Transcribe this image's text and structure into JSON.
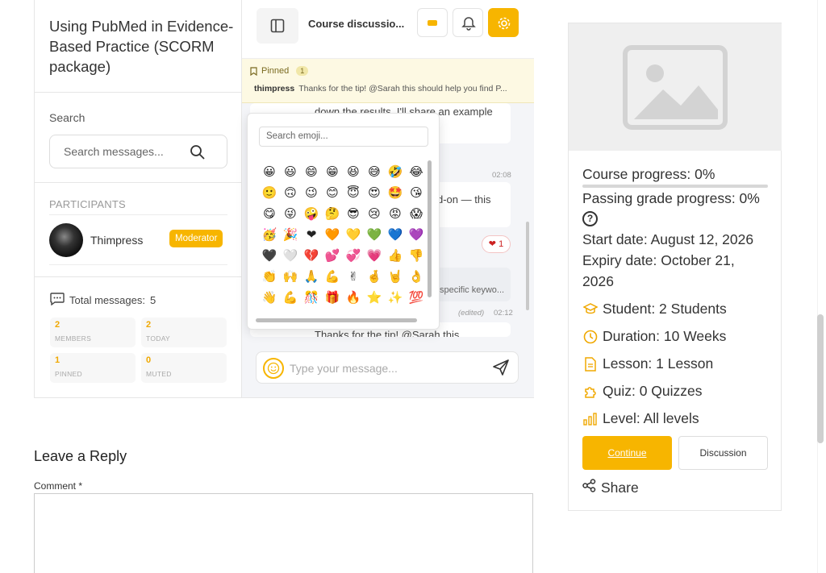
{
  "chat": {
    "course_title": "Using PubMed in Evidence-Based Practice (SCORM package)",
    "search_label": "Search",
    "search_placeholder": "Search messages...",
    "participants_heading": "PARTICIPANTS",
    "participant": {
      "name": "Thimpress",
      "role": "Moderator"
    },
    "total_messages_label": "Total messages:",
    "total_messages_value": "5",
    "stats": [
      {
        "value": "2",
        "label": "MEMBERS"
      },
      {
        "value": "2",
        "label": "TODAY"
      },
      {
        "value": "1",
        "label": "PINNED"
      },
      {
        "value": "0",
        "label": "MUTED"
      }
    ],
    "header_title": "Course discussio...",
    "pinned_label": "Pinned",
    "pinned_count": "1",
    "pinned_author": "thimpress",
    "pinned_text": "Thanks for the tip! @Sarah this should help you find P...",
    "messages": [
      {
        "text": "down the results. I'll share an example"
      },
      {
        "time": "02:08"
      },
      {
        "text": "d-on — this"
      },
      {
        "text": "specific keywo..."
      },
      {
        "edited": "(edited)",
        "time": "02:12"
      },
      {
        "text": "Thanks for the tip! @Sarah this"
      }
    ],
    "reaction": {
      "emoji": "❤",
      "count": "1"
    },
    "composer_placeholder": "Type your message...",
    "emoji_search_placeholder": "Search emoji...",
    "emojis": [
      "😀",
      "😃",
      "😄",
      "😁",
      "😆",
      "😅",
      "🤣",
      "😂",
      "🙂",
      "🙃",
      "😉",
      "😊",
      "😇",
      "😍",
      "🤩",
      "😘",
      "😋",
      "😜",
      "🤪",
      "🤔",
      "😎",
      "😢",
      "😡",
      "😱",
      "🥳",
      "🎉",
      "❤",
      "🧡",
      "💛",
      "💚",
      "💙",
      "💜",
      "🖤",
      "🤍",
      "💔",
      "💕",
      "💞",
      "💗",
      "👍",
      "👎",
      "👏",
      "🙌",
      "🙏",
      "💪",
      "✌",
      "🤞",
      "🤘",
      "👌",
      "👋",
      "💪",
      "🎊",
      "🎁",
      "🔥",
      "⭐",
      "✨",
      "💯"
    ]
  },
  "reply": {
    "title": "Leave a Reply",
    "comment_label": "Comment *"
  },
  "course": {
    "course_progress": "Course progress: 0%",
    "passing_progress": "Passing grade progress: 0%",
    "help_icon": "?",
    "start_date": "Start date: August 12, 2026",
    "expiry_line1": "Expiry date: October 21,",
    "expiry_line2": "2026",
    "progress_values": {
      "course": 0,
      "passing": 0
    },
    "meta": [
      {
        "icon": "student-icon",
        "text": "Student: 2 Students"
      },
      {
        "icon": "clock-icon",
        "text": "Duration: 10 Weeks"
      },
      {
        "icon": "file-icon",
        "text": "Lesson: 1 Lesson"
      },
      {
        "icon": "puzzle-icon",
        "text": "Quiz: 0 Quizzes"
      },
      {
        "icon": "level-icon",
        "text": "Level: All levels"
      }
    ],
    "continue_label": "Continue",
    "discussion_label": "Discussion",
    "share_label": "Share",
    "accent": "#f7b500"
  }
}
